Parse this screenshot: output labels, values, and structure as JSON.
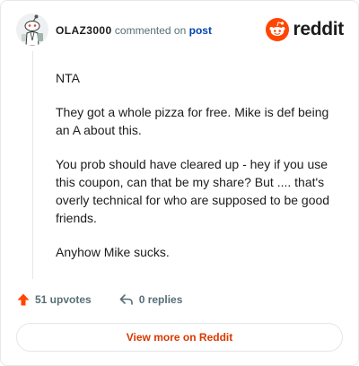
{
  "comment": {
    "author": "OLAZ3000",
    "action_text": "commented on",
    "link_text": "post",
    "paragraphs": [
      "NTA",
      "They got a whole pizza for free. Mike is def being an A about this.",
      "You prob should have cleared up - hey if you use this coupon, can that be my share? But .... that's overly technical for who are supposed to be good friends.",
      "Anyhow Mike sucks."
    ]
  },
  "brand": {
    "wordmark": "reddit",
    "accent_color": "#ff4500",
    "icon": "reddit-snoo-icon"
  },
  "footer": {
    "upvotes": "51 upvotes",
    "replies": "0 replies",
    "upvote_icon": "upvote-arrow-icon",
    "reply_icon": "reply-arrow-icon",
    "upvote_color": "#ff4500"
  },
  "actions": {
    "view_more": "View more on Reddit"
  },
  "avatar": {
    "icon": "snoo-avatar-icon"
  }
}
